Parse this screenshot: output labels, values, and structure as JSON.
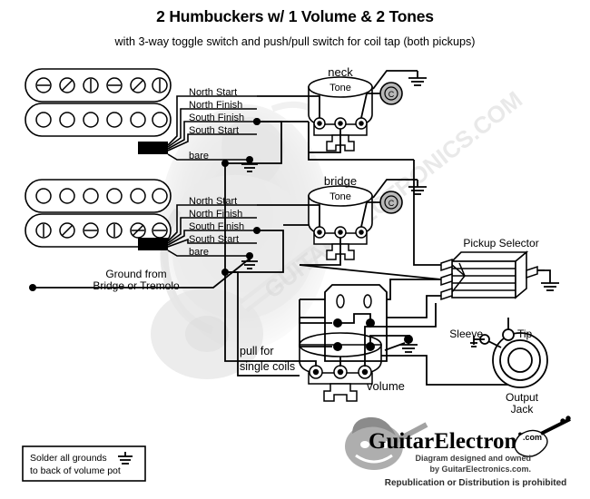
{
  "document": {
    "title": "2 Humbuckers w/ 1 Volume & 2 Tones",
    "subtitle": "with 3-way toggle switch and push/pull switch for coil tap (both pickups)"
  },
  "pickups": {
    "neck": {
      "name": "neck-humbucker",
      "wires": [
        "North Start",
        "North Finish",
        "South Finish",
        "South Start",
        "bare"
      ]
    },
    "bridge": {
      "name": "bridge-humbucker",
      "wires": [
        "North Start",
        "North Finish",
        "South Finish",
        "South Start",
        "bare"
      ]
    }
  },
  "ground_note": {
    "line1": "Ground from",
    "line2": "Bridge or Tremolo"
  },
  "pots": {
    "neck_tone": {
      "label": "neck",
      "body_label": "Tone",
      "cap_label": "C"
    },
    "bridge_tone": {
      "label": "bridge",
      "body_label": "Tone",
      "cap_label": "C"
    },
    "volume": {
      "label": "volume",
      "push_pull_line1": "pull for",
      "push_pull_line2": "single coils"
    }
  },
  "selector": {
    "label": "Pickup Selector"
  },
  "jack": {
    "sleeve_label": "Sleeve",
    "tip_label": "Tip",
    "name_line1": "Output",
    "name_line2": "Jack"
  },
  "solder_note": {
    "line1": "Solder all grounds",
    "line2": "to back of volume pot"
  },
  "footer": {
    "logo": "GuitarElectronics",
    "logo_suffix": ".com",
    "credit_line1": "Diagram designed and owned",
    "credit_line2": "by GuitarElectronics.com.",
    "notice": "Republication or Distribution is prohibited"
  },
  "watermark": {
    "text": "GUITARELECTRONICS.COM"
  },
  "colors": {
    "ink": "#000000",
    "paper": "#ffffff",
    "cap_fill": "#b8b8b8",
    "watermark": "#d8d8d8"
  }
}
